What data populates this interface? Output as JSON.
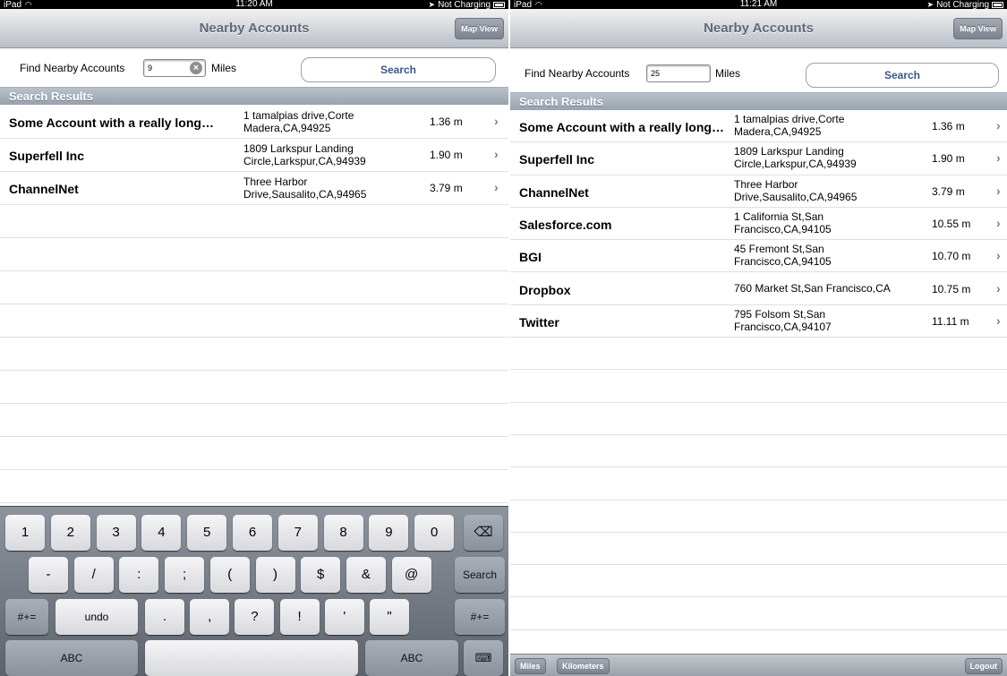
{
  "status_bar": {
    "left": {
      "device": "iPad",
      "time": "11:20 AM",
      "battery": "Not Charging"
    },
    "right": {
      "device": "iPad",
      "time": "11:21 AM",
      "battery": "Not Charging"
    }
  },
  "nav": {
    "title": "Nearby Accounts",
    "map_view_label": "Map View"
  },
  "find": {
    "label": "Find Nearby Accounts",
    "left_value": "9",
    "right_value": "25",
    "unit_label": "Miles",
    "search_label": "Search"
  },
  "section_header": "Search Results",
  "accounts": [
    {
      "name": "Some Account with a really long…",
      "addr1": "1 tamalpias drive,Corte",
      "addr2": "Madera,CA,94925",
      "distance": "1.36 m"
    },
    {
      "name": "Superfell Inc",
      "addr1": "1809 Larkspur Landing",
      "addr2": "Circle,Larkspur,CA,94939",
      "distance": "1.90 m"
    },
    {
      "name": "ChannelNet",
      "addr1": "Three Harbor",
      "addr2": "Drive,Sausalito,CA,94965",
      "distance": "3.79 m"
    },
    {
      "name": "Salesforce.com",
      "addr1": "1 California St,San",
      "addr2": "Francisco,CA,94105",
      "distance": "10.55 m"
    },
    {
      "name": "BGI",
      "addr1": "45 Fremont St,San",
      "addr2": "Francisco,CA,94105",
      "distance": "10.70 m"
    },
    {
      "name": "Dropbox",
      "addr1": "760 Market St,San Francisco,CA",
      "addr2": "",
      "distance": "10.75 m"
    },
    {
      "name": "Twitter",
      "addr1": "795 Folsom St,San",
      "addr2": "Francisco,CA,94107",
      "distance": "11.11 m"
    }
  ],
  "keyboard": {
    "row1": [
      "1",
      "2",
      "3",
      "4",
      "5",
      "6",
      "7",
      "8",
      "9",
      "0"
    ],
    "delete_icon": "backspace-icon",
    "row2": [
      "-",
      "/",
      ":",
      ";",
      "(",
      ")",
      "$",
      "&",
      "@"
    ],
    "search_key": "Search",
    "row3_left": "#+=",
    "undo": "undo",
    "row3": [
      ".",
      ",",
      "?",
      "!",
      "'",
      "\""
    ],
    "row3_right": "#+=",
    "abc_left": "ABC",
    "abc_right": "ABC",
    "dismiss_icon": "keyboard-dismiss-icon"
  },
  "toolbar": {
    "miles": "Miles",
    "kilometers": "Kilometers",
    "logout": "Logout"
  }
}
